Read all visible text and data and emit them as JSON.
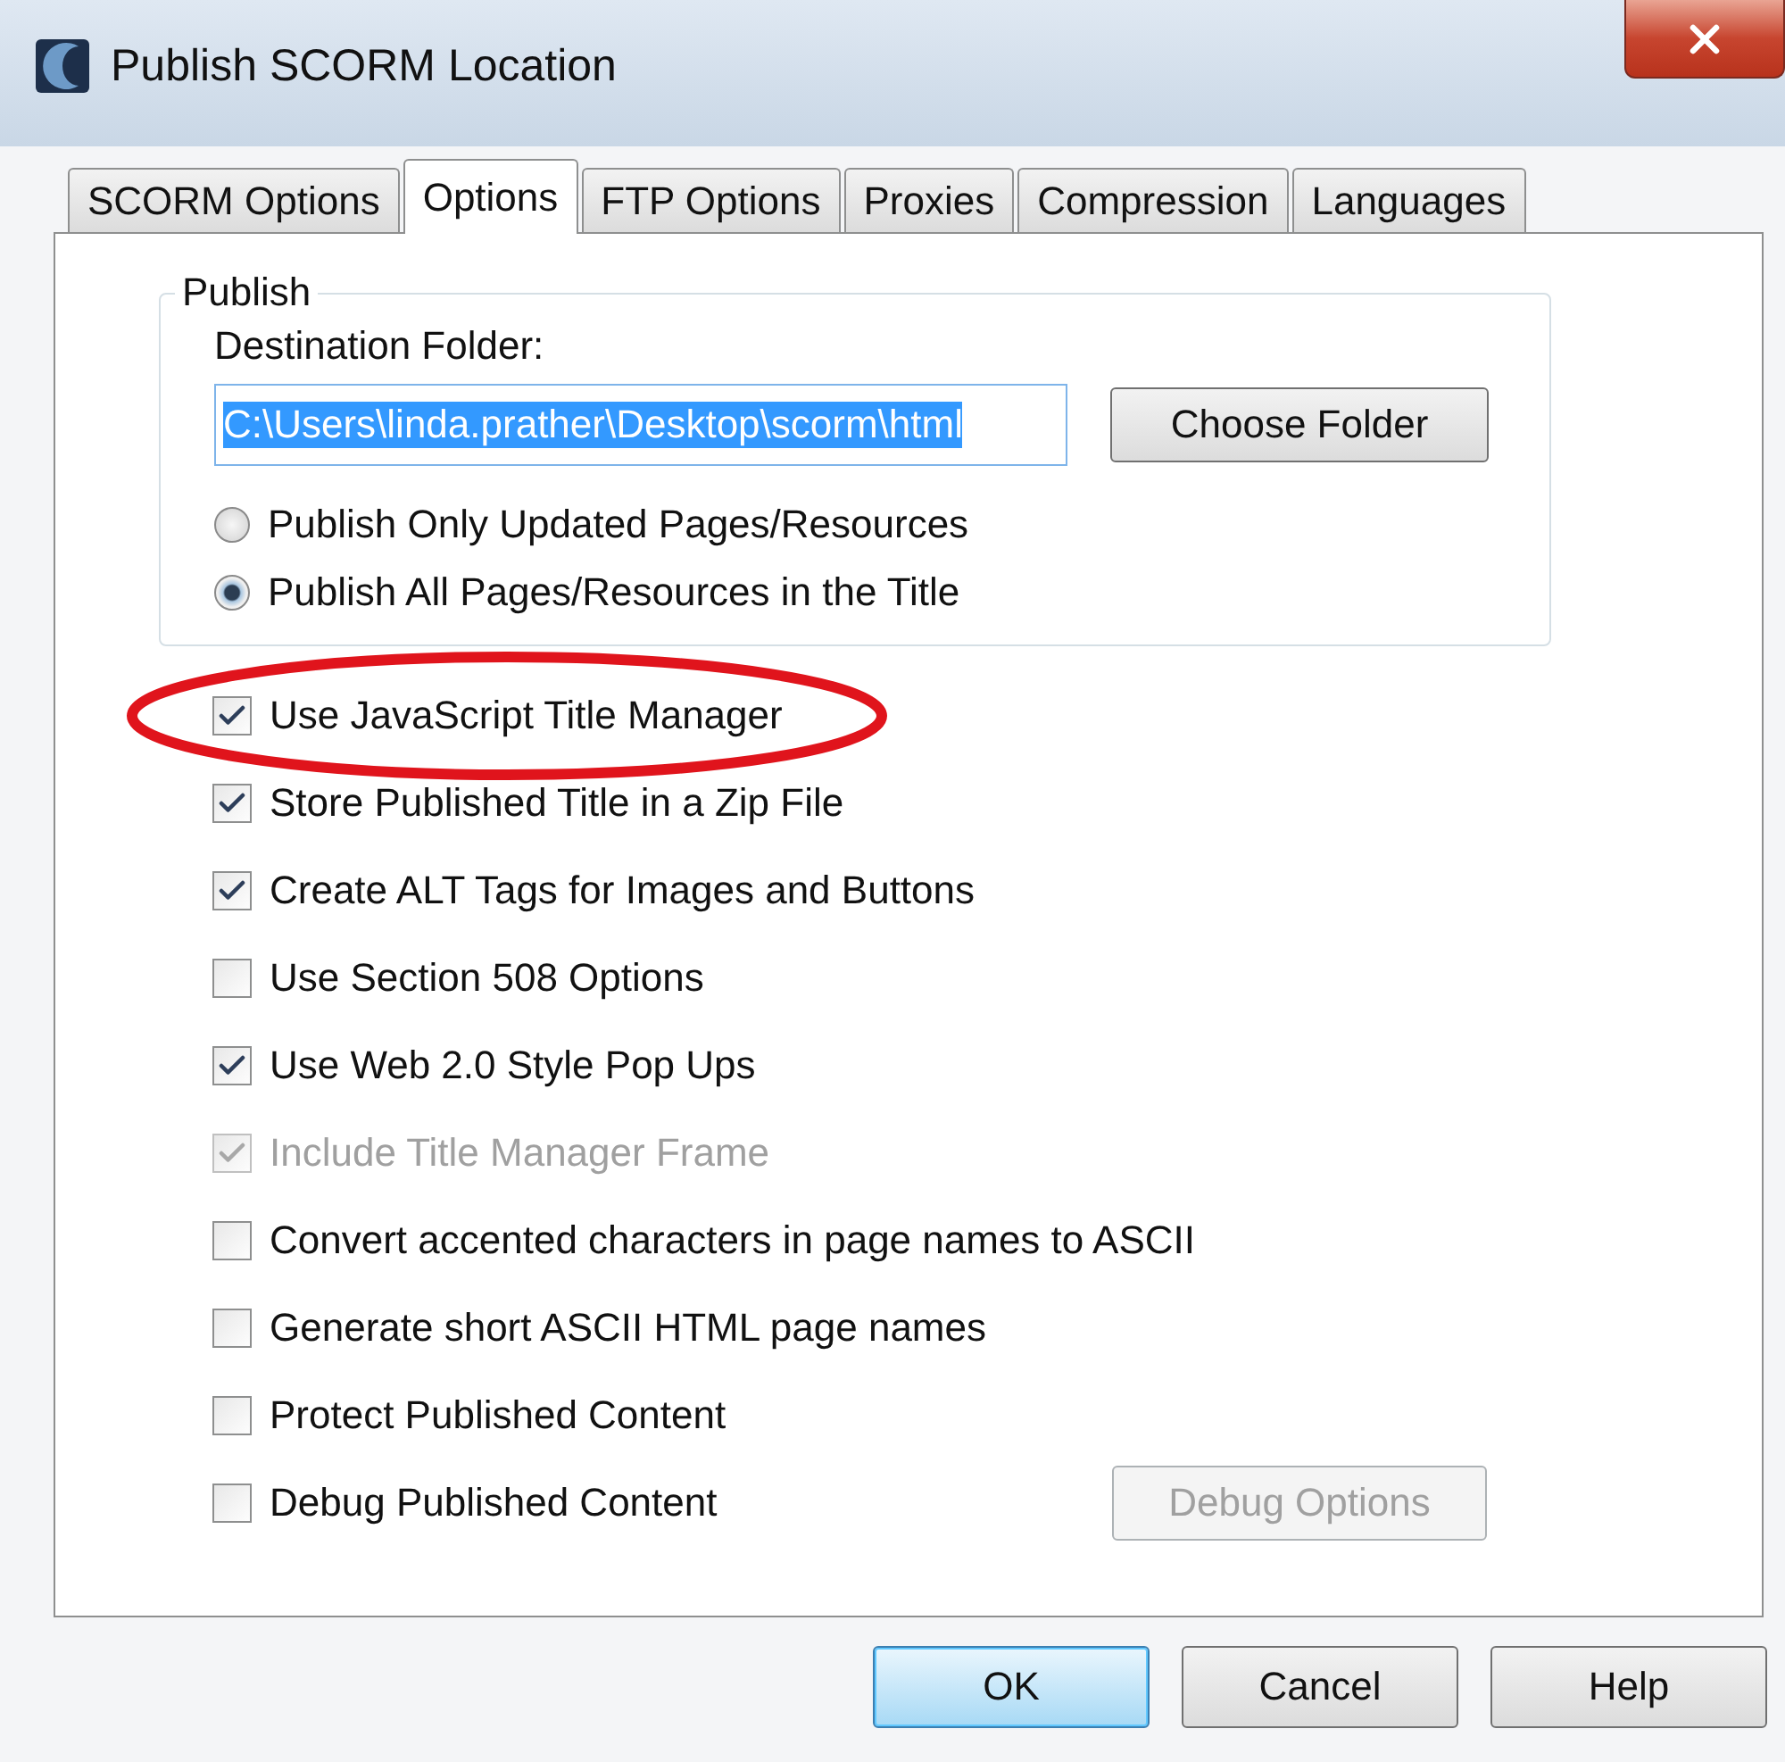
{
  "window": {
    "title": "Publish SCORM Location"
  },
  "tabs": [
    {
      "label": "SCORM Options",
      "selected": false
    },
    {
      "label": "Options",
      "selected": true
    },
    {
      "label": "FTP Options",
      "selected": false
    },
    {
      "label": "Proxies",
      "selected": false
    },
    {
      "label": "Compression",
      "selected": false
    },
    {
      "label": "Languages",
      "selected": false
    }
  ],
  "publish": {
    "legend": "Publish",
    "destination_label": "Destination Folder:",
    "destination_value": "C:\\Users\\linda.prather\\Desktop\\scorm\\html",
    "choose_button": "Choose Folder",
    "radios": [
      {
        "label": "Publish Only Updated Pages/Resources",
        "selected": false
      },
      {
        "label": "Publish All Pages/Resources in the Title",
        "selected": true
      }
    ]
  },
  "options": [
    {
      "label": "Use JavaScript Title Manager",
      "checked": true,
      "disabled": false,
      "circled": true
    },
    {
      "label": "Store Published Title in a Zip File",
      "checked": true,
      "disabled": false,
      "circled": false
    },
    {
      "label": "Create ALT Tags for Images and Buttons",
      "checked": true,
      "disabled": false,
      "circled": false
    },
    {
      "label": "Use Section 508 Options",
      "checked": false,
      "disabled": false,
      "circled": false
    },
    {
      "label": "Use Web 2.0 Style Pop Ups",
      "checked": true,
      "disabled": false,
      "circled": false
    },
    {
      "label": "Include Title Manager Frame",
      "checked": true,
      "disabled": true,
      "circled": false
    },
    {
      "label": "Convert accented characters in page names to ASCII",
      "checked": false,
      "disabled": false,
      "circled": false
    },
    {
      "label": "Generate short ASCII HTML page names",
      "checked": false,
      "disabled": false,
      "circled": false
    },
    {
      "label": "Protect Published Content",
      "checked": false,
      "disabled": false,
      "circled": false
    },
    {
      "label": "Debug Published Content",
      "checked": false,
      "disabled": false,
      "circled": false,
      "button": {
        "label": "Debug Options",
        "disabled": true
      }
    }
  ],
  "buttons": [
    {
      "label": "OK",
      "focused": true
    },
    {
      "label": "Cancel",
      "focused": false
    },
    {
      "label": "Help",
      "focused": false
    }
  ]
}
